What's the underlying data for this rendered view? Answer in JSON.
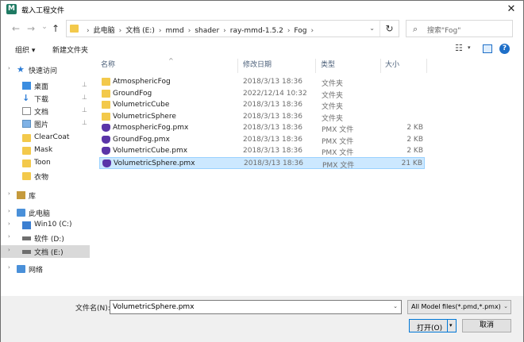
{
  "window": {
    "title": "载入工程文件",
    "app_icon": "mmd-app-icon",
    "close_glyph": "✕"
  },
  "nav": {
    "back": "←",
    "forward": "→",
    "up_dropdown": "⌄",
    "up": "↑",
    "refresh": "↻"
  },
  "address": {
    "crumbs": [
      "此电脑",
      "文档 (E:)",
      "mmd",
      "shader",
      "ray-mmd-1.5.2",
      "Fog"
    ],
    "leading_sep": "›",
    "sep": "›",
    "dropdown": "⌄"
  },
  "search": {
    "placeholder": "搜索\"Fog\"",
    "icon": "⌕"
  },
  "toolbar": {
    "organize": "组织 ▾",
    "new_folder": "新建文件夹",
    "view_icon": "☷",
    "view_dd": "▾",
    "help": "?"
  },
  "sidebar": {
    "items": [
      {
        "label": "快速访问",
        "icon": "star-icon",
        "glyph": "★",
        "chevron": "›"
      },
      {
        "label": "桌面",
        "icon": "desktop-icon",
        "pinned": true
      },
      {
        "label": "下载",
        "icon": "download-icon",
        "glyph": "↓",
        "pinned": true
      },
      {
        "label": "文档",
        "icon": "document-icon",
        "pinned": true
      },
      {
        "label": "图片",
        "icon": "picture-icon",
        "pinned": true
      },
      {
        "label": "ClearCoat",
        "icon": "folder-icon"
      },
      {
        "label": "Mask",
        "icon": "folder-icon"
      },
      {
        "label": "Toon",
        "icon": "folder-icon"
      },
      {
        "label": "衣物",
        "icon": "folder-icon"
      },
      {
        "label": "库",
        "icon": "library-icon",
        "chevron": "›"
      },
      {
        "label": "此电脑",
        "icon": "computer-icon",
        "chevron": "›"
      },
      {
        "label": "Win10 (C:)",
        "icon": "drive-c-icon",
        "chevron": "›"
      },
      {
        "label": "软件 (D:)",
        "icon": "drive-icon",
        "chevron": "›"
      },
      {
        "label": "文档 (E:)",
        "icon": "drive-icon",
        "chevron": "›",
        "selected": true
      },
      {
        "label": "网络",
        "icon": "network-icon",
        "chevron": "›"
      }
    ],
    "pin_glyph": "📌"
  },
  "columns": {
    "name": "名称",
    "date": "修改日期",
    "type": "类型",
    "size": "大小",
    "sort_glyph": "^"
  },
  "files": [
    {
      "name": "AtmosphericFog",
      "date": "2018/3/13 18:36",
      "type": "文件夹",
      "size": "",
      "kind": "folder"
    },
    {
      "name": "GroundFog",
      "date": "2022/12/14 10:32",
      "type": "文件夹",
      "size": "",
      "kind": "folder"
    },
    {
      "name": "VolumetricCube",
      "date": "2018/3/13 18:36",
      "type": "文件夹",
      "size": "",
      "kind": "folder"
    },
    {
      "name": "VolumetricSphere",
      "date": "2018/3/13 18:36",
      "type": "文件夹",
      "size": "",
      "kind": "folder"
    },
    {
      "name": "AtmosphericFog.pmx",
      "date": "2018/3/13 18:36",
      "type": "PMX 文件",
      "size": "2 KB",
      "kind": "pmx"
    },
    {
      "name": "GroundFog.pmx",
      "date": "2018/3/13 18:36",
      "type": "PMX 文件",
      "size": "2 KB",
      "kind": "pmx"
    },
    {
      "name": "VolumetricCube.pmx",
      "date": "2018/3/13 18:36",
      "type": "PMX 文件",
      "size": "2 KB",
      "kind": "pmx"
    },
    {
      "name": "VolumetricSphere.pmx",
      "date": "2018/3/13 18:36",
      "type": "PMX 文件",
      "size": "21 KB",
      "kind": "pmx",
      "selected": true
    }
  ],
  "footer": {
    "filename_label": "文件名(N):",
    "filename_value": "VolumetricSphere.pmx",
    "filter": "All Model files(*.pmd,*.pmx)",
    "open": "打开(O)",
    "cancel": "取消",
    "dropdown": "⌄",
    "split_dd": "▾"
  },
  "colors": {
    "selection": "#cce8ff",
    "selection_border": "#99d1ff",
    "folder": "#f3c94b",
    "pmx": "#5a35a8",
    "accent": "#0078d7"
  }
}
